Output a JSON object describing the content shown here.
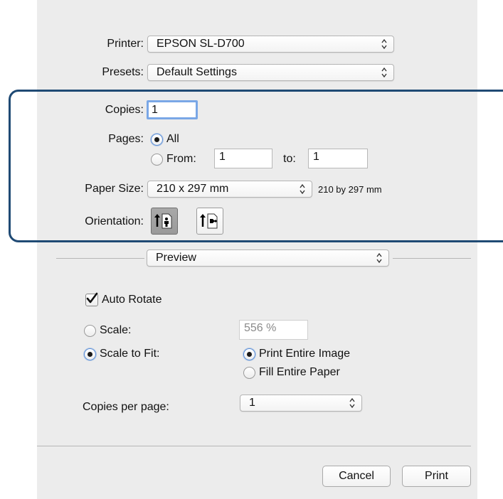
{
  "printer": {
    "label": "Printer:",
    "value": "EPSON SL-D700"
  },
  "presets": {
    "label": "Presets:",
    "value": "Default Settings"
  },
  "copies": {
    "label": "Copies:",
    "value": "1"
  },
  "pages": {
    "label": "Pages:",
    "all_label": "All",
    "from_label": "From:",
    "from_value": "1",
    "to_label": "to:",
    "to_value": "1"
  },
  "paper_size": {
    "label": "Paper Size:",
    "value": "210 x 297 mm",
    "description": "210 by 297 mm"
  },
  "orientation": {
    "label": "Orientation:",
    "selected": "portrait"
  },
  "section": {
    "value": "Preview"
  },
  "preview": {
    "auto_rotate_label": "Auto Rotate",
    "auto_rotate_checked": true,
    "scale_label": "Scale:",
    "scale_value": "556 %",
    "scale_to_fit_label": "Scale to Fit:",
    "print_entire_image_label": "Print Entire Image",
    "fill_entire_paper_label": "Fill Entire Paper",
    "copies_per_page_label": "Copies per page:",
    "copies_per_page_value": "1"
  },
  "buttons": {
    "cancel": "Cancel",
    "print": "Print"
  },
  "colors": {
    "highlight": "#1f4a74",
    "panel": "#ececec",
    "accent": "#5b8fd8"
  }
}
